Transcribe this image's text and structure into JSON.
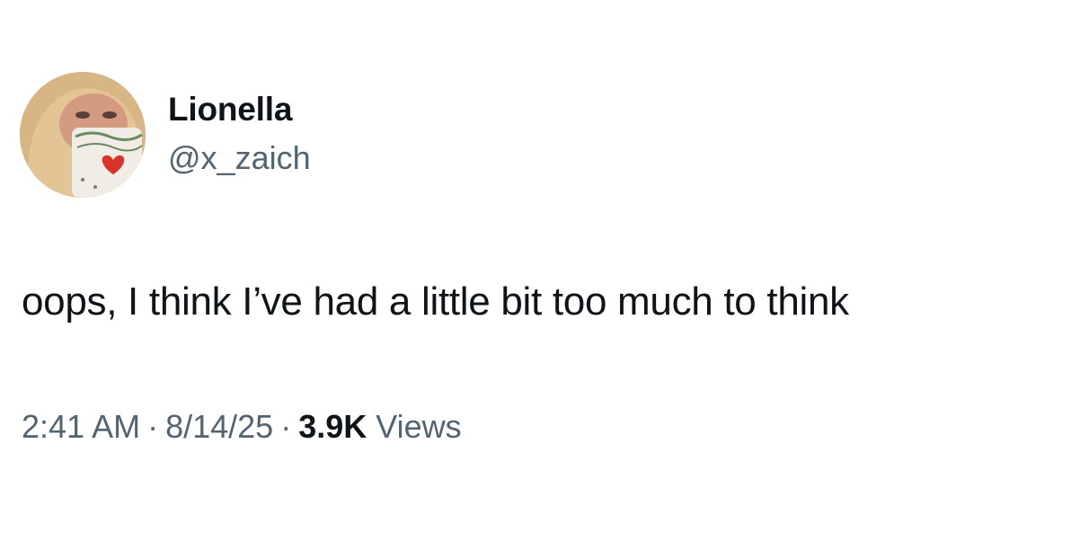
{
  "user": {
    "display_name": "Lionella",
    "handle": "@x_zaich",
    "avatar": "profile-photo-avatar"
  },
  "tweet": {
    "text": "oops, I think I’ve had a little bit too much to think"
  },
  "meta": {
    "time": "2:41 AM",
    "separator": "·",
    "date": "8/14/25",
    "views_count": "3.9K",
    "views_label": "Views"
  },
  "colors": {
    "text_primary": "#0f1419",
    "text_secondary": "#536471",
    "background": "#ffffff"
  }
}
